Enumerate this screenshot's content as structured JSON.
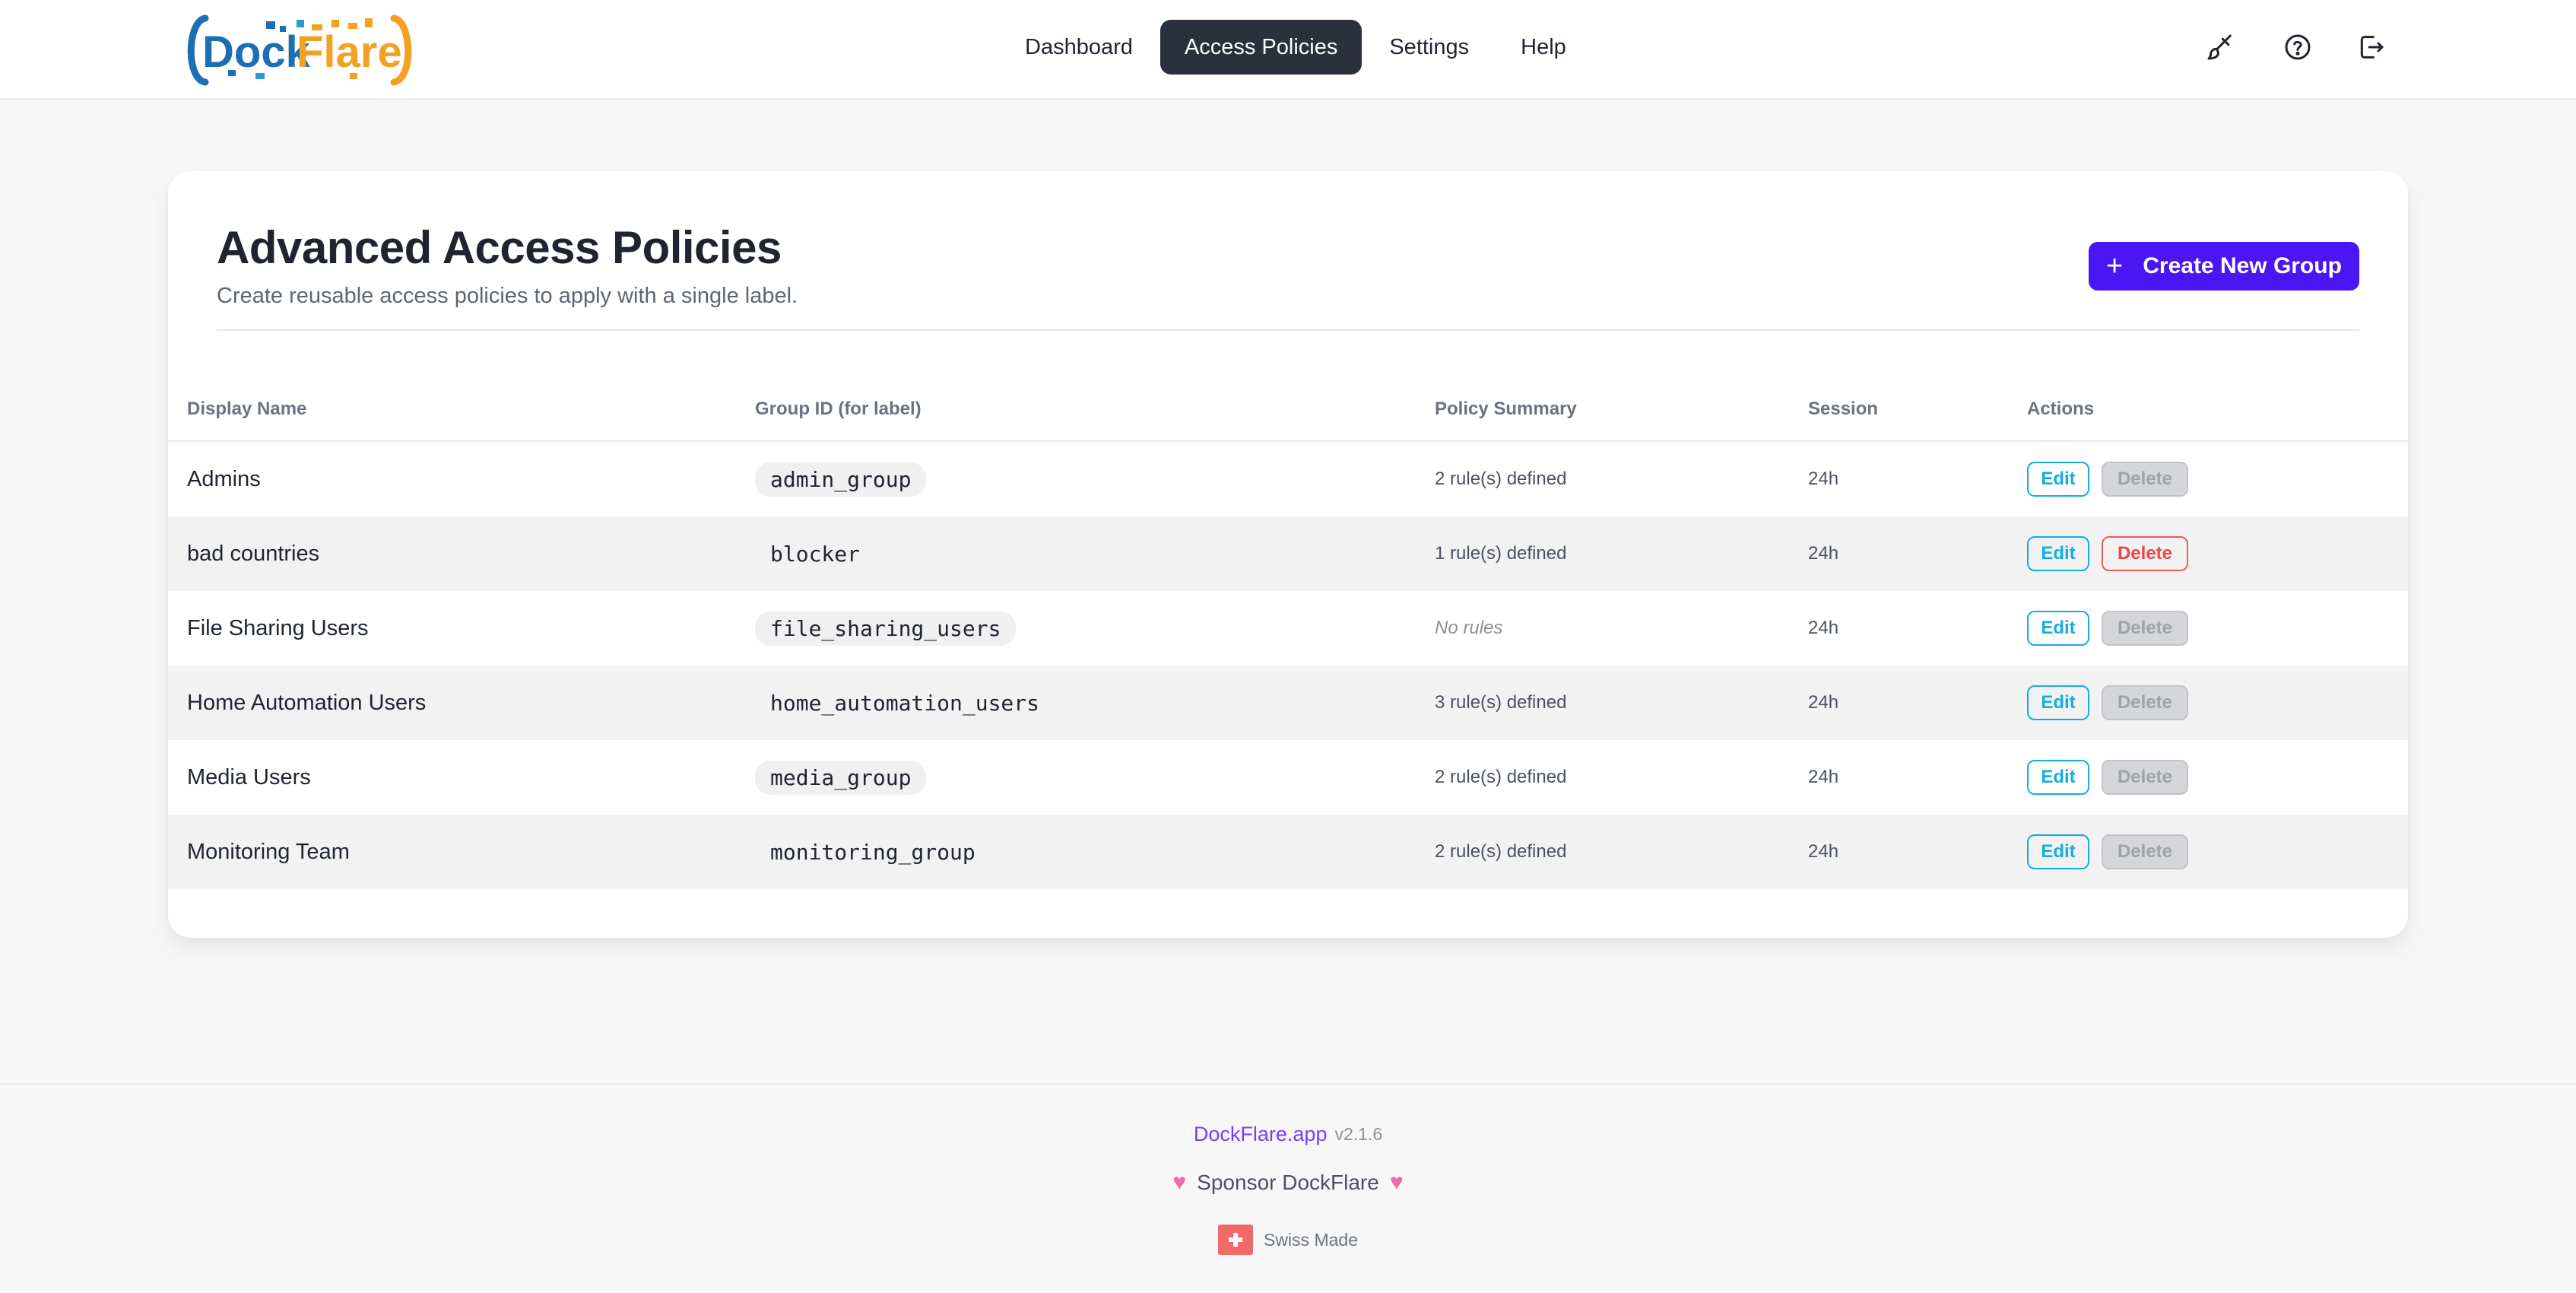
{
  "app": {
    "logo_text_part1": "Dock",
    "logo_text_part2": "Flare",
    "colors": {
      "brand_blue": "#1b6fb3",
      "brand_orange": "#f4a020",
      "accent": "#4a16f4",
      "nav_active": "#2a303c"
    }
  },
  "nav": {
    "items": [
      {
        "label": "Dashboard",
        "active": false
      },
      {
        "label": "Access Policies",
        "active": true
      },
      {
        "label": "Settings",
        "active": false
      },
      {
        "label": "Help",
        "active": false
      }
    ],
    "icons": [
      "brush-icon",
      "help-circle-icon",
      "logout-icon"
    ]
  },
  "page": {
    "title": "Advanced Access Policies",
    "subtitle": "Create reusable access policies to apply with a single label.",
    "create_button": "Create New Group"
  },
  "table": {
    "headers": [
      "Display Name",
      "Group ID (for label)",
      "Policy Summary",
      "Session",
      "Actions"
    ],
    "edit_label": "Edit",
    "delete_label": "Delete",
    "rows": [
      {
        "name": "Admins",
        "group_id": "admin_group",
        "policy": "2 rule(s) defined",
        "session": "24h",
        "delete_enabled": false
      },
      {
        "name": "bad countries",
        "group_id": "blocker",
        "policy": "1 rule(s) defined",
        "session": "24h",
        "delete_enabled": true
      },
      {
        "name": "File Sharing Users",
        "group_id": "file_sharing_users",
        "policy": "No rules",
        "session": "24h",
        "delete_enabled": false
      },
      {
        "name": "Home Automation Users",
        "group_id": "home_automation_users",
        "policy": "3 rule(s) defined",
        "session": "24h",
        "delete_enabled": false
      },
      {
        "name": "Media Users",
        "group_id": "media_group",
        "policy": "2 rule(s) defined",
        "session": "24h",
        "delete_enabled": false
      },
      {
        "name": "Monitoring Team",
        "group_id": "monitoring_group",
        "policy": "2 rule(s) defined",
        "session": "24h",
        "delete_enabled": false
      }
    ]
  },
  "footer": {
    "brand": "DockFlare.app",
    "version": "v2.1.6",
    "sponsor": "Sponsor DockFlare",
    "made": "Swiss Made"
  }
}
